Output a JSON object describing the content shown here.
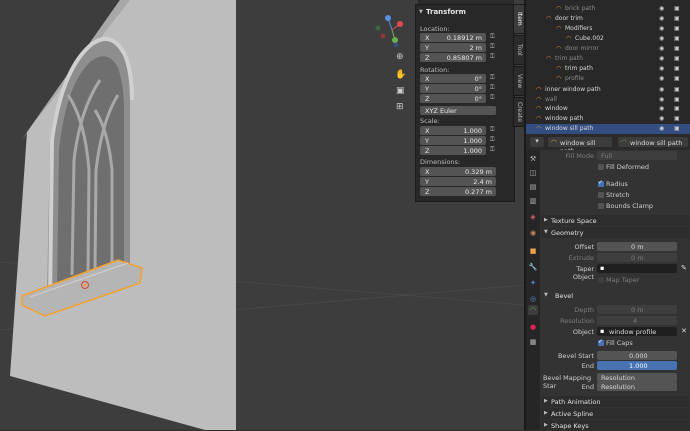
{
  "n_panel": {
    "tabs": [
      "Item",
      "Tool",
      "View",
      "Create"
    ],
    "transform_title": "Transform",
    "location_label": "Location:",
    "location": [
      {
        "axis": "X",
        "value": "0.18912 m"
      },
      {
        "axis": "Y",
        "value": "2 m"
      },
      {
        "axis": "Z",
        "value": "0.85807 m"
      }
    ],
    "rotation_label": "Rotation:",
    "rotation": [
      {
        "axis": "X",
        "value": "0°"
      },
      {
        "axis": "Y",
        "value": "0°"
      },
      {
        "axis": "Z",
        "value": "0°"
      }
    ],
    "rotation_mode": "XYZ Euler",
    "scale_label": "Scale:",
    "scale": [
      {
        "axis": "X",
        "value": "1.000"
      },
      {
        "axis": "Y",
        "value": "1.000"
      },
      {
        "axis": "Z",
        "value": "1.000"
      }
    ],
    "dimensions_label": "Dimensions:",
    "dimensions": [
      {
        "axis": "X",
        "value": "0.329 m"
      },
      {
        "axis": "Y",
        "value": "2.4 m"
      },
      {
        "axis": "Z",
        "value": "0.277 m"
      }
    ]
  },
  "outliner": {
    "rows": [
      {
        "name": "brick path",
        "indent": 3,
        "dim": true
      },
      {
        "name": "door trim",
        "indent": 2,
        "dim": false
      },
      {
        "name": "Modifiers",
        "indent": 3,
        "dim": false
      },
      {
        "name": "Cube.002",
        "indent": 4,
        "dim": false
      },
      {
        "name": "door mirror",
        "indent": 3,
        "dim": true
      },
      {
        "name": "trim path",
        "indent": 2,
        "dim": true
      },
      {
        "name": "trim path",
        "indent": 3,
        "dim": false
      },
      {
        "name": "profile",
        "indent": 3,
        "dim": true
      },
      {
        "name": "inner window path",
        "indent": 1,
        "dim": false
      },
      {
        "name": "wall",
        "indent": 1,
        "dim": true
      },
      {
        "name": "window",
        "indent": 1,
        "dim": false
      },
      {
        "name": "window path",
        "indent": 1,
        "dim": false
      },
      {
        "name": "window sill path",
        "indent": 1,
        "dim": false,
        "selected": true
      }
    ]
  },
  "properties": {
    "header_object": "window sill path",
    "header_data": "window sill path",
    "fill_mode_label": "Fill Mode",
    "fill_mode_value": "Full",
    "fill_deformed": "Fill Deformed",
    "radius": "Radius",
    "stretch": "Stretch",
    "bounds_clamp": "Bounds Clamp",
    "texture_space": "Texture Space",
    "geometry": "Geometry",
    "offset_label": "Offset",
    "offset_value": "0 m",
    "extrude_label": "Extrude",
    "extrude_value": "0 m",
    "taper_label": "Taper Object",
    "map_taper": "Map Taper",
    "bevel": "Bevel",
    "depth_label": "Depth",
    "depth_value": "0 m",
    "resolution_label": "Resolution",
    "resolution_value": "4",
    "object_label": "Object",
    "object_value": "window profile",
    "fill_caps": "Fill Caps",
    "bevel_start_label": "Bevel Start",
    "bevel_start_value": "0.000",
    "end_label": "End",
    "end_value": "1.000",
    "bevel_mapping_label": "Bevel Mapping Star",
    "bevel_mapping_value": "Resolution",
    "end2_label": "End",
    "end2_value": "Resolution",
    "path_animation": "Path Animation",
    "active_spline": "Active Spline",
    "shape_keys": "Shape Keys"
  },
  "colors": {
    "accent": "#4772b3",
    "selection": "#334d80",
    "outline_orange": "#f5a12a"
  }
}
